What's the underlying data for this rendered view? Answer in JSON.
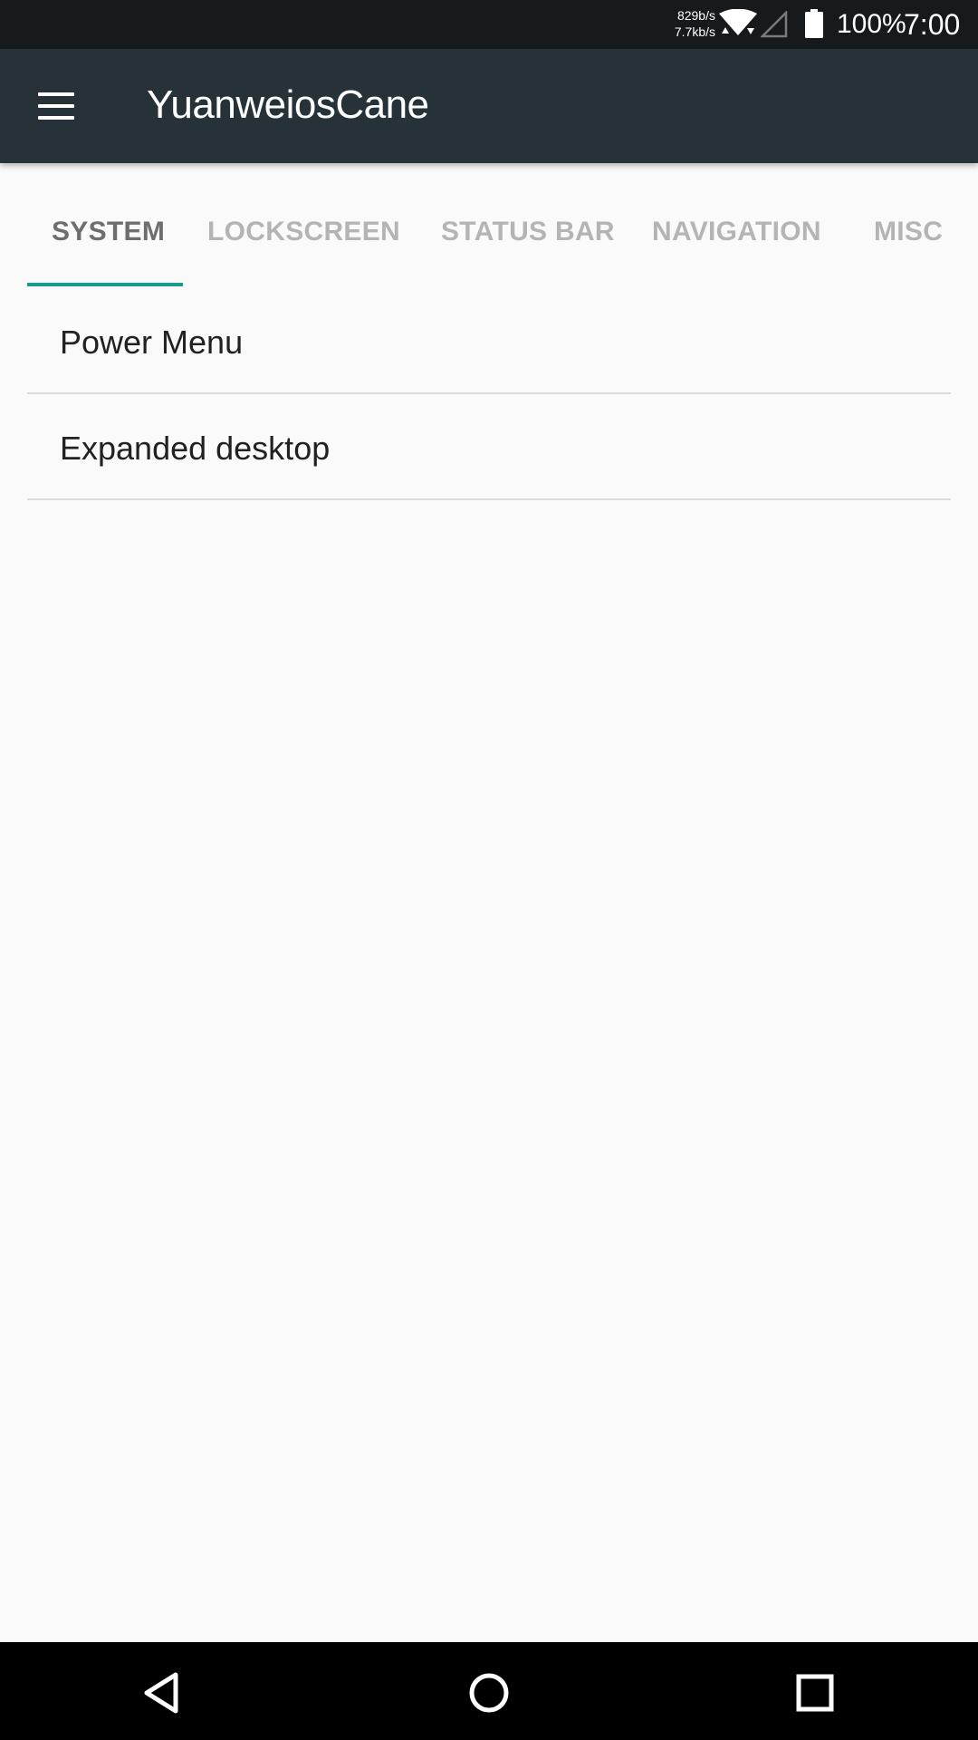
{
  "status_bar": {
    "upload_speed": "829b/s",
    "download_speed": "7.7kb/s",
    "battery_percent": "100%",
    "time": "7:00",
    "icons": [
      "wifi-icon",
      "cell-signal-icon",
      "battery-icon"
    ]
  },
  "app_bar": {
    "title": "YuanweiosCane",
    "menu_icon": "hamburger-menu-icon"
  },
  "tabs": [
    {
      "label": "SYSTEM",
      "active": true
    },
    {
      "label": "LOCKSCREEN",
      "active": false
    },
    {
      "label": "STATUS BAR",
      "active": false
    },
    {
      "label": "NAVIGATION",
      "active": false
    },
    {
      "label": "MISC",
      "active": false
    }
  ],
  "preferences": [
    {
      "label": "Power Menu"
    },
    {
      "label": "Expanded desktop"
    }
  ],
  "nav_bar": {
    "icons": [
      "back-icon",
      "home-icon",
      "recents-icon"
    ]
  },
  "colors": {
    "status_bar_bg": "#161a1d",
    "app_bar_bg": "#263238",
    "accent": "#1a9a8c",
    "background": "#fafafa",
    "tab_active_text": "#6e6e6e",
    "tab_inactive_text": "#b4b4b4"
  }
}
